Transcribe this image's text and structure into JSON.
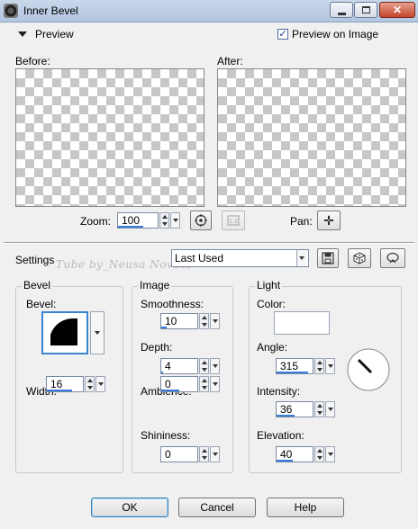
{
  "window": {
    "title": "Inner Bevel",
    "close_glyph": "✕"
  },
  "preview": {
    "section_label": "Preview",
    "preview_on_image_label": "Preview on Image",
    "preview_on_image_checked": true,
    "before_label": "Before:",
    "after_label": "After:",
    "zoom_label": "Zoom:",
    "zoom_value": "100",
    "pan_label": "Pan:",
    "move_glyph": "✛"
  },
  "settings": {
    "label": "Settings",
    "preset_value": "Last Used",
    "watermark": "Tube by_Neusa Novaes"
  },
  "bevel_group": {
    "title": "Bevel",
    "bevel_label": "Bevel:",
    "width_label": "Width:",
    "width_value": "16"
  },
  "image_group": {
    "title": "Image",
    "smoothness_label": "Smoothness:",
    "smoothness_value": "10",
    "depth_label": "Depth:",
    "depth_value": "4",
    "ambience_label": "Ambience:",
    "ambience_value": "0",
    "shininess_label": "Shininess:",
    "shininess_value": "0"
  },
  "light_group": {
    "title": "Light",
    "color_label": "Color:",
    "color_value": "#ffffff",
    "angle_label": "Angle:",
    "angle_value": "315",
    "intensity_label": "Intensity:",
    "intensity_value": "36",
    "elevation_label": "Elevation:",
    "elevation_value": "40"
  },
  "buttons": {
    "ok": "OK",
    "cancel": "Cancel",
    "help": "Help"
  },
  "colors": {
    "accent": "#3a7be0",
    "title_bar": "#b3c6e0",
    "close_button": "#c4462b"
  }
}
